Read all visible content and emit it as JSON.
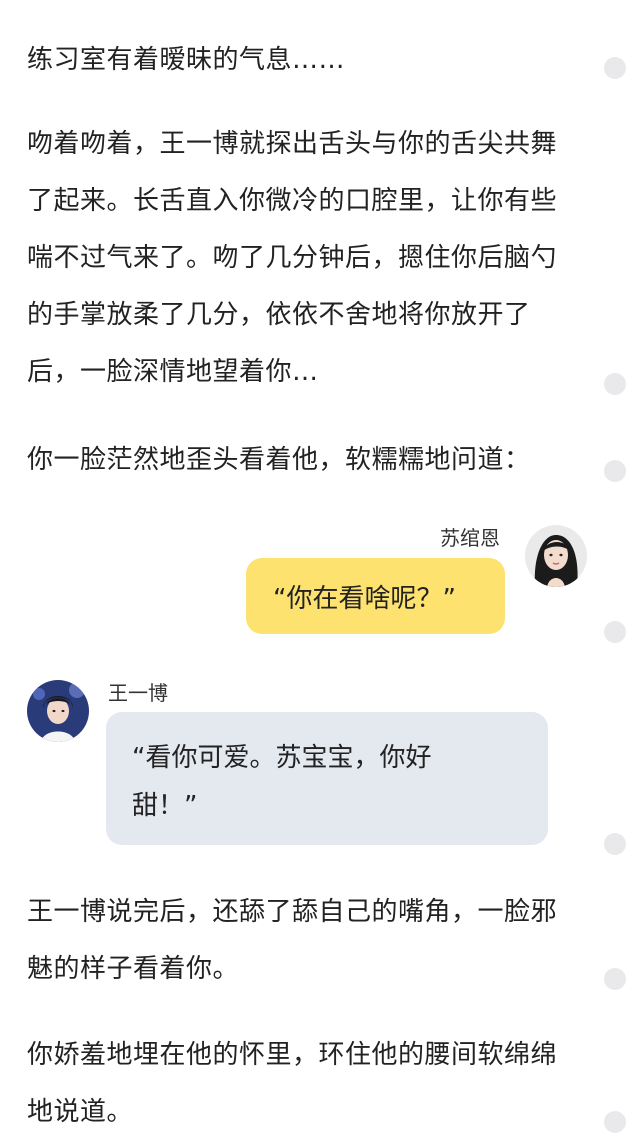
{
  "story": {
    "para1": "练习室有着暧昧的气息……",
    "para2": "吻着吻着，王一博就探出舌头与你的舌尖共舞了起来。长舌直入你微冷的口腔里，让你有些喘不过气来了。吻了几分钟后，摁住你后脑勺的手掌放柔了几分，依依不舍地将你放开了后，一脸深情地望着你…",
    "para3": "你一脸茫然地歪头看着他，软糯糯地问道：",
    "para4": "王一博说完后，还舔了舔自己的嘴角，一脸邪魅的样子看着你。",
    "para5": "你娇羞地埋在他的怀里，环住他的腰间软绵绵地说道。"
  },
  "chat": {
    "right": {
      "name": "苏绾恩",
      "text": "“你在看啥呢？”",
      "avatar_icon": "girl-portrait-avatar",
      "bubble_color": "#fde26f"
    },
    "left": {
      "name": "王一博",
      "text": "“看你可爱。苏宝宝，你好甜！”",
      "avatar_icon": "boy-portrait-avatar",
      "bubble_color": "#e4e8ef"
    }
  }
}
